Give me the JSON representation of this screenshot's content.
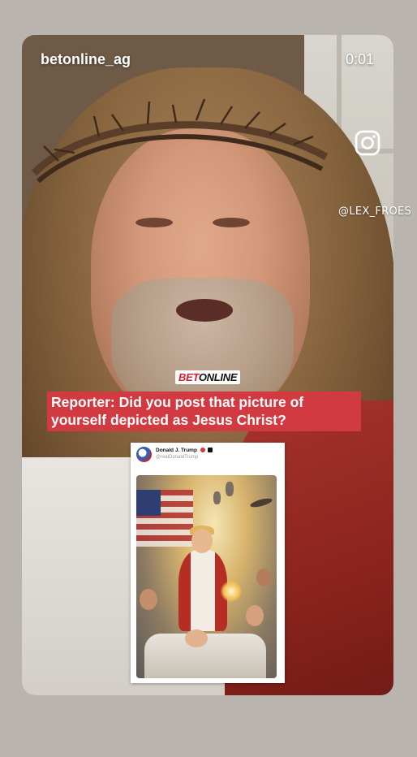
{
  "story": {
    "account": "betonline_ag",
    "timer": "0:01",
    "watermark_handle": "@LEX_FROES",
    "watermark_icon": "instagram-icon"
  },
  "video": {
    "brand_logo_bet": "BET",
    "brand_logo_online": "ONLINE",
    "caption": "Reporter: Did you post that picture of yourself depicted as Jesus Christ?"
  },
  "embedded_post": {
    "author": "Donald J. Trump",
    "handle": "@realDonaldTrump"
  },
  "colors": {
    "caption_bg": "#d23a42",
    "logo_red": "#d21f2b",
    "page_bg": "#b9b4ad"
  }
}
